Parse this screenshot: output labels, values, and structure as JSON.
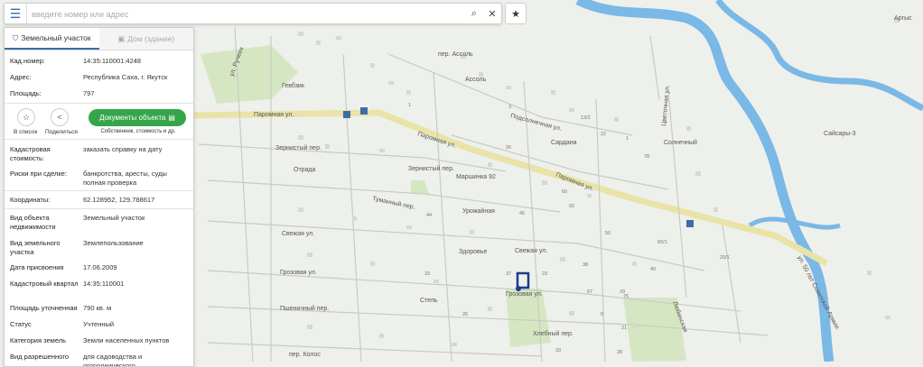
{
  "search": {
    "placeholder": "введите номер или адрес",
    "menu_icon": "menu-icon",
    "search_icon": "search-icon",
    "clear_icon": "close-icon",
    "fav_icon": "star-icon"
  },
  "tabs": [
    {
      "label": "Земельный участок",
      "icon": "land-plot-icon"
    },
    {
      "label": "Дом (здание)",
      "icon": "building-icon"
    }
  ],
  "info": {
    "kad_number_label": "Кад.номер:",
    "kad_number": "14:35:110001:4248",
    "address_label": "Адрес:",
    "address": "Республика Саха, г. Якутск",
    "area_label": "Площадь:",
    "area": "797",
    "kad_cost_label": "Кадастровая стоимость:",
    "kad_cost_link": "заказать справку на дату",
    "risks_label": "Риски при сделке:",
    "risks": "банкротства, аресты, суды",
    "risks_link": "полная проверка",
    "coords_label": "Координаты:",
    "coords": "62.128952, 129.788617",
    "object_type_label": "Вид объекта недвижимости",
    "object_type": "Земельный участок",
    "land_type_label": "Вид земельного участка",
    "land_type": "Землепользование",
    "assign_date_label": "Дата присвоения",
    "assign_date": "17.06.2009",
    "kad_quarter_label": "Кадастровый квартал",
    "kad_quarter": "14:35:110001",
    "refined_area_label": "Площадь уточненная",
    "refined_area": "790 кв. м",
    "status_label": "Статус",
    "status": "Учтенный",
    "land_category_label": "Категория земель",
    "land_category": "Земли населенных пунктов",
    "permitted_use_label": "Вид разрешенного",
    "permitted_use": "для садоводства и огороднического"
  },
  "actions": {
    "to_list": "В список",
    "share": "Поделиться",
    "docs_button": "Документы объекта",
    "docs_sub": "Собственник, стоимость и др."
  },
  "map": {
    "streets": {
      "paromnaya1": "Паромная ул.",
      "paromnaya2": "Паромная ул.",
      "paromnaya3": "Паромная ул.",
      "assol_per": "пер. Ассоль",
      "assol": "Ассоль",
      "gevidzhik": "Гевбзик",
      "zernist_per": "Зернистый пер.",
      "zernist_per2": "Зернистый пер.",
      "otrada": "Отрада",
      "marshinka": "Маршинка 92",
      "tumanny": "Туманный пер.",
      "urozhaynaya": "Урожайная",
      "svezhaya1": "Свежая ул.",
      "svezhaya2": "Свежая ул.",
      "zdorovye": "Здоровье",
      "grozovaya1": "Грозовая ул.",
      "grozovaya2": "Грозовая ул.",
      "step": "Степь",
      "pshenichny": "Пшеничный пер.",
      "khlebny": "Хлебный пер.",
      "kolos": "пер. Колос",
      "podsolnechnaya": "Подсолнечная ул.",
      "sardana": "Сардана",
      "solnechny": "Солнечный",
      "tsvetochnaya": "Цветочная ул.",
      "saysary": "Сайсары-3",
      "arges": "Аргыс",
      "sovarmii": "ул. 50 лет Советской Армии",
      "rucheyok": "ул. Ручеек",
      "lyubinskaya": "Любинская"
    },
    "house_numbers": [
      "33",
      "3",
      "44",
      "46",
      "20/1",
      "13/2",
      "22",
      "60",
      "1",
      "26",
      "78",
      "92",
      "60/1",
      "50",
      "29",
      "23",
      "6",
      "75",
      "67",
      "40",
      "21",
      "38",
      "26",
      "37",
      "33",
      "28",
      "1"
    ]
  }
}
